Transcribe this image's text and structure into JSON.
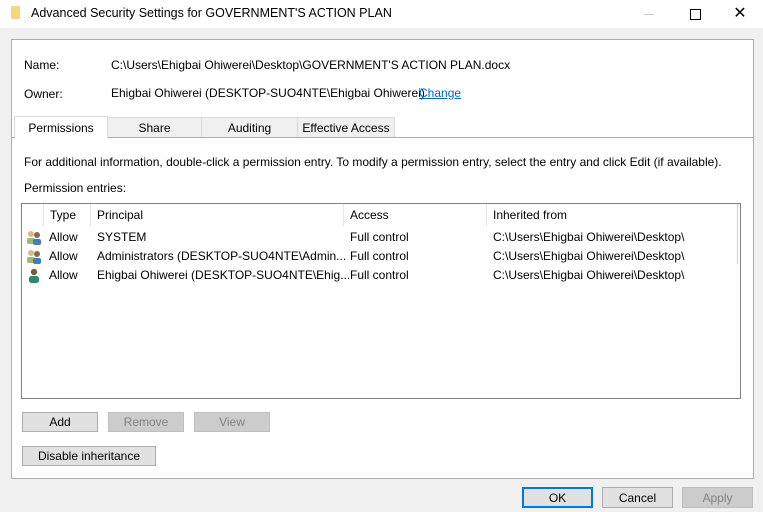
{
  "window": {
    "title": "Advanced Security Settings for GOVERNMENT'S ACTION PLAN",
    "icon": "folder-icon",
    "controls": {
      "minimize": "minimize-icon",
      "maximize": "maximize-icon",
      "close": "close-icon"
    }
  },
  "info": {
    "name_label": "Name:",
    "name_value": "C:\\Users\\Ehigbai Ohiwerei\\Desktop\\GOVERNMENT'S ACTION PLAN.docx",
    "owner_label": "Owner:",
    "owner_value": "Ehigbai Ohiwerei (DESKTOP-SUO4NTE\\Ehigbai Ohiwerei)",
    "change_link": "Change"
  },
  "tabs": [
    {
      "label": "Permissions",
      "active": true
    },
    {
      "label": "Share",
      "active": false
    },
    {
      "label": "Auditing",
      "active": false
    },
    {
      "label": "Effective Access",
      "active": false
    }
  ],
  "permissions": {
    "instructions": "For additional information, double-click a permission entry. To modify a permission entry, select the entry and click Edit (if available).",
    "entries_label": "Permission entries:",
    "columns": [
      "Type",
      "Principal",
      "Access",
      "Inherited from"
    ],
    "rows": [
      {
        "icon": "group-users-icon",
        "type": "Allow",
        "principal": "SYSTEM",
        "access": "Full control",
        "inherited_from": "C:\\Users\\Ehigbai Ohiwerei\\Desktop\\"
      },
      {
        "icon": "group-users-icon",
        "type": "Allow",
        "principal": "Administrators (DESKTOP-SUO4NTE\\Admin...",
        "access": "Full control",
        "inherited_from": "C:\\Users\\Ehigbai Ohiwerei\\Desktop\\"
      },
      {
        "icon": "single-user-icon",
        "type": "Allow",
        "principal": "Ehigbai Ohiwerei (DESKTOP-SUO4NTE\\Ehig...",
        "access": "Full control",
        "inherited_from": "C:\\Users\\Ehigbai Ohiwerei\\Desktop\\"
      }
    ],
    "buttons": {
      "add": "Add",
      "remove": "Remove",
      "view": "View",
      "disable_inheritance": "Disable inheritance"
    }
  },
  "footer": {
    "ok": "OK",
    "cancel": "Cancel",
    "apply": "Apply"
  },
  "colors": {
    "link": "#0066cc",
    "default_button_border": "#0078d7",
    "folder": "#f6d67a"
  }
}
